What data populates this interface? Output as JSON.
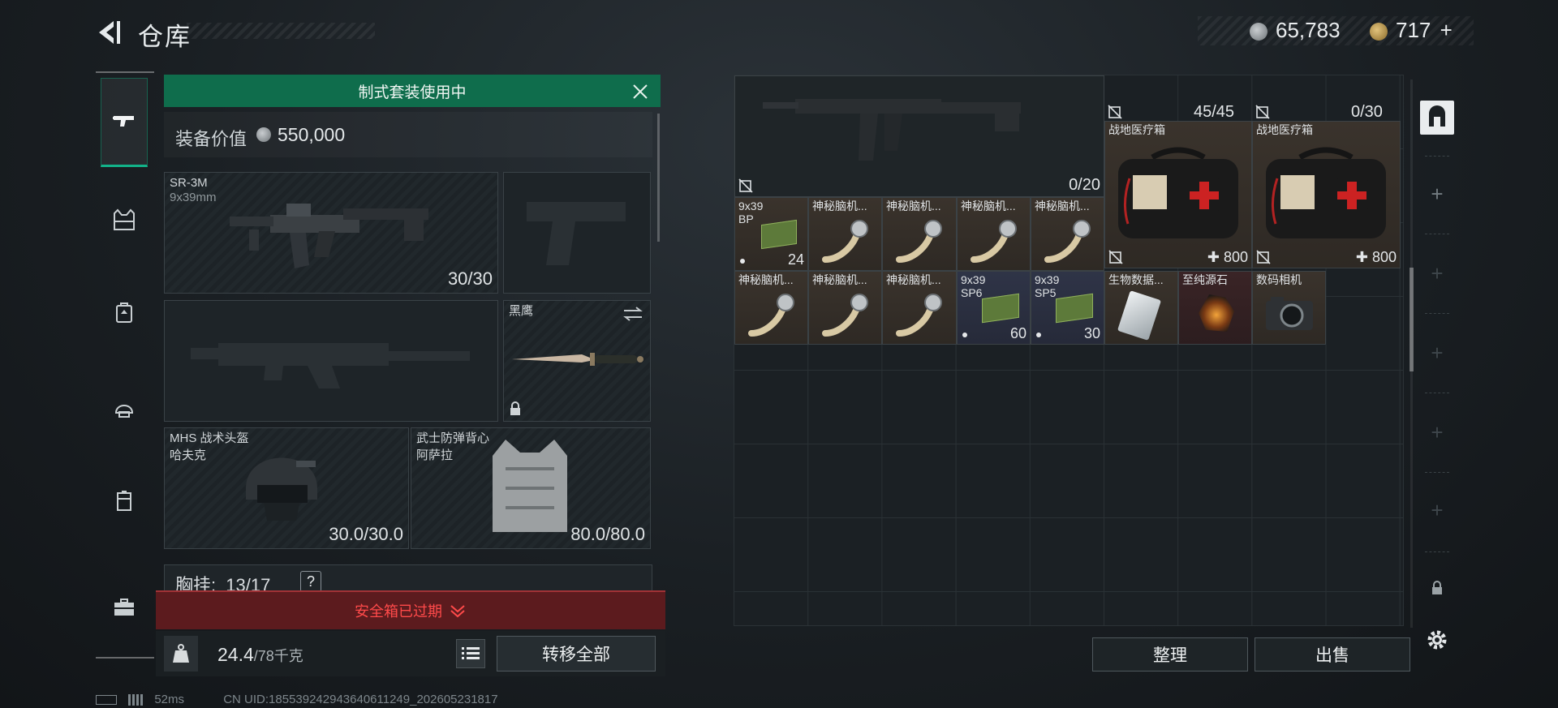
{
  "header": {
    "title": "仓库",
    "currency_silver": "65,783",
    "currency_gold": "717",
    "currency_gold_add": "+"
  },
  "kit_banner": "制式套装使用中",
  "equipment_value": {
    "label": "装备价值",
    "value": "550,000"
  },
  "slots": {
    "primary": {
      "name": "SR-3M",
      "caliber": "9x39mm",
      "ammo": "30/30"
    },
    "melee": {
      "name": "黑鹰"
    },
    "helmet": {
      "name": "MHS 战术头盔",
      "sub": "哈夫克",
      "durability": "30.0/30.0"
    },
    "armor": {
      "name": "武士防弹背心",
      "sub": "阿萨拉",
      "durability": "80.0/80.0"
    }
  },
  "rig": {
    "label": "胸挂:",
    "value": "13/17",
    "help": "?"
  },
  "safe_box": {
    "label": "安全箱已过期"
  },
  "weight": {
    "value": "24.4",
    "max": "/78千克"
  },
  "buttons": {
    "transfer_all": "转移全部",
    "sort": "整理",
    "sell": "出售"
  },
  "status": {
    "ping": "52ms",
    "uid": "CN UID:18553924294364061124​9_202605231817"
  },
  "stash": {
    "rifle_ammo": "0/20",
    "medkit_a": {
      "name": "战地医疗箱",
      "count": "45/45",
      "value": "800"
    },
    "medkit_b": {
      "name": "战地医疗箱",
      "count": "0/30",
      "value": "800"
    },
    "items": [
      {
        "label": "9x39 BP",
        "count": "24"
      },
      {
        "label": "神秘脑机..."
      },
      {
        "label": "神秘脑机..."
      },
      {
        "label": "神秘脑机..."
      },
      {
        "label": "神秘脑机..."
      },
      {
        "label": "神秘脑机..."
      },
      {
        "label": "神秘脑机..."
      },
      {
        "label": "神秘脑机..."
      },
      {
        "label": "9x39 SP6",
        "count": "60"
      },
      {
        "label": "9x39 SP5",
        "count": "30"
      },
      {
        "label": "生物数据..."
      },
      {
        "label": "至纯源石"
      },
      {
        "label": "数码相机"
      }
    ]
  },
  "right_column": {
    "add": "+",
    "add2": "+",
    "add3": "+",
    "add4": "+",
    "add5": "+",
    "add6": "+"
  }
}
